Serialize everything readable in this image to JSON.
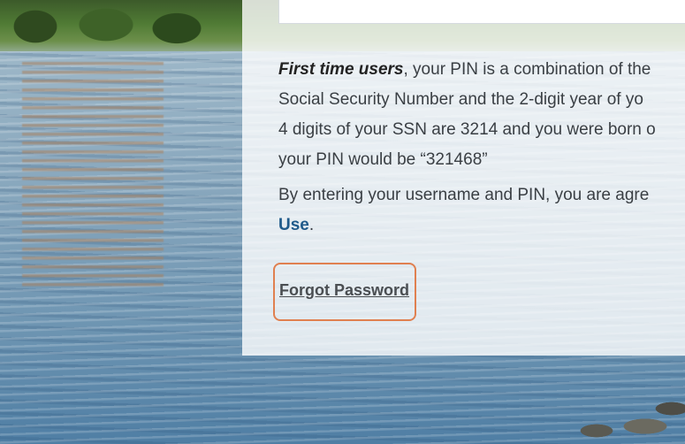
{
  "instructions": {
    "first_time_label": "First time users",
    "line1_rest": ", your PIN is a combination of the",
    "line2": "Social Security Number and the 2-digit year of yo",
    "line3": "4 digits of your SSN are 3214 and you were born o",
    "line4": "your PIN would be “321468”"
  },
  "agreement": {
    "line1": "By entering your username and PIN, you are agre",
    "terms_link": "Use",
    "period": "."
  },
  "forgot_password": {
    "label": "Forgot Password",
    "highlight_color": "#e08050"
  },
  "colors": {
    "link": "#1f5a8a",
    "text": "#3a3f44"
  }
}
